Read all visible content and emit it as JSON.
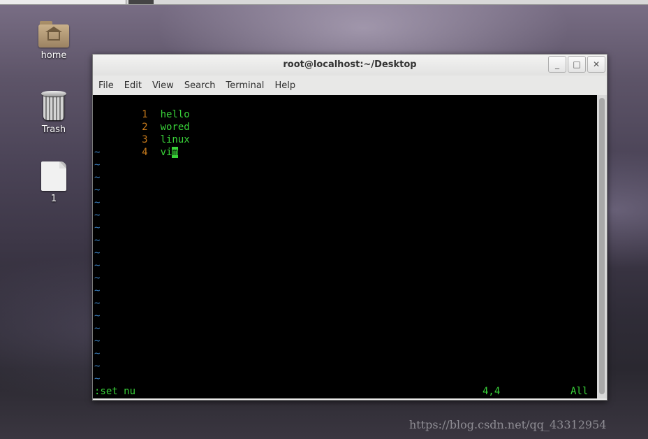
{
  "desktop": {
    "icons": [
      {
        "label": "home",
        "icon": "home-folder-icon"
      },
      {
        "label": "Trash",
        "icon": "trash-icon"
      },
      {
        "label": "1",
        "icon": "file-icon"
      }
    ],
    "watermark": "https://blog.csdn.net/qq_43312954"
  },
  "window": {
    "title": "root@localhost:~/Desktop",
    "buttons": {
      "minimize": "_",
      "maximize": "□",
      "close": "✕"
    },
    "menu": [
      "File",
      "Edit",
      "View",
      "Search",
      "Terminal",
      "Help"
    ]
  },
  "editor": {
    "lines": [
      {
        "num": "1",
        "text": "hello"
      },
      {
        "num": "2",
        "text": "wored"
      },
      {
        "num": "3",
        "text": "linux"
      },
      {
        "num": "4",
        "text_before": "vi",
        "cursor_char": "m"
      }
    ],
    "tilde": "~",
    "status": {
      "command": ":set nu",
      "position": "4,4",
      "scroll": "All"
    }
  },
  "colors": {
    "line_number": "#c77a1b",
    "text": "#39d339",
    "tilde": "#3b7fbf"
  }
}
